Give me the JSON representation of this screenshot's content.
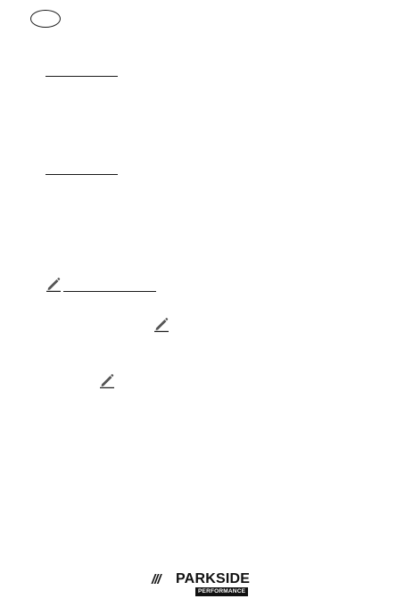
{
  "icons": {
    "language_badge": "oval-badge-icon",
    "edit": "pencil-icon"
  },
  "brand": {
    "slashes": "///",
    "name": "PARKSIDE",
    "sub": "PERFORMANCE"
  },
  "colors": {
    "ink": "#1a1a1a",
    "pencil": "#555555"
  }
}
